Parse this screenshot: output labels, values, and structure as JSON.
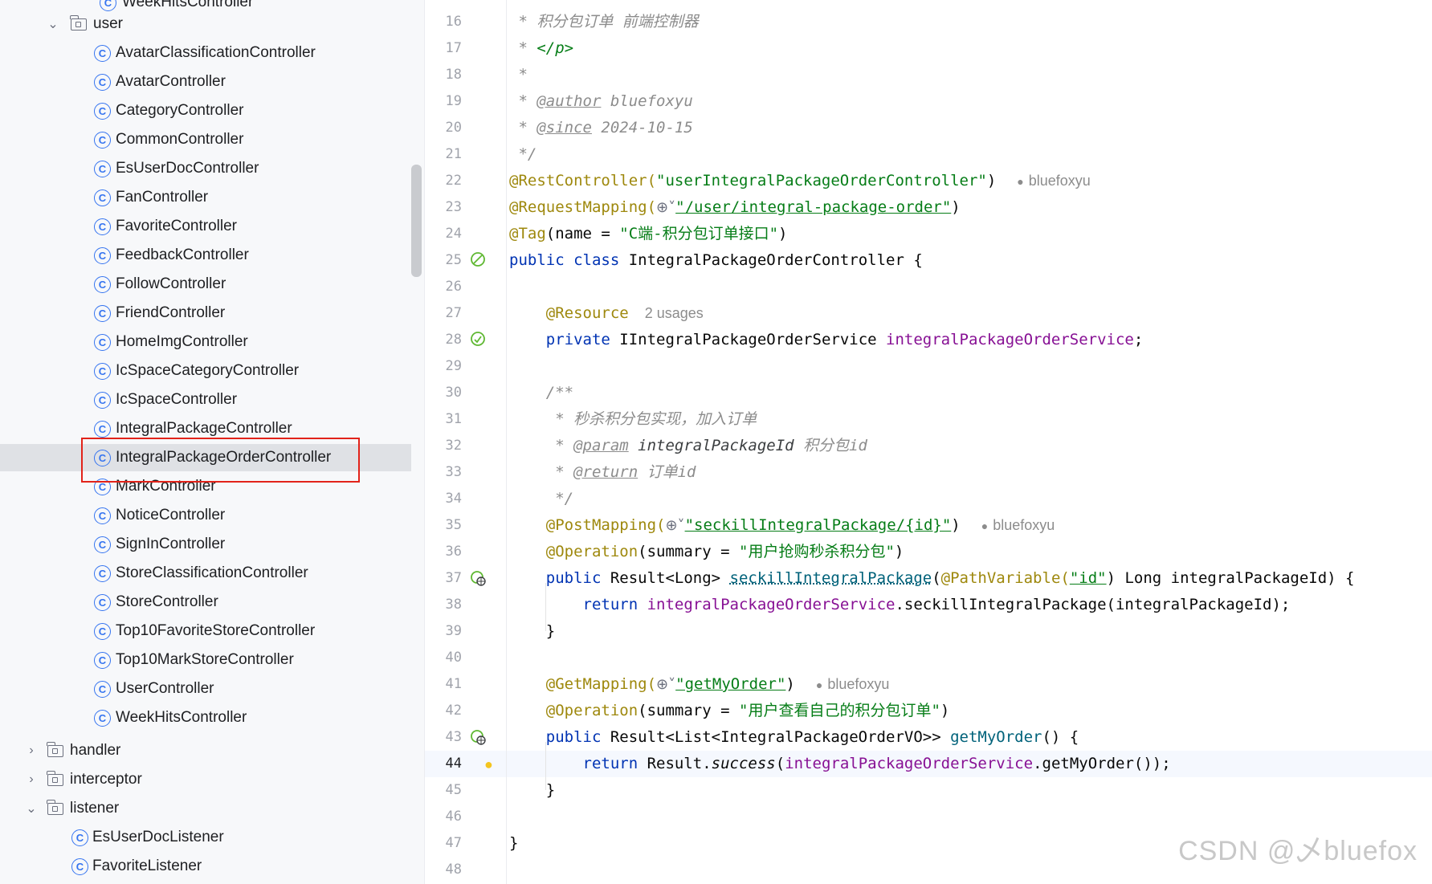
{
  "tree": {
    "top_folder": "user",
    "user_classes": [
      "AvatarClassificationController",
      "AvatarController",
      "CategoryController",
      "CommonController",
      "EsUserDocController",
      "FanController",
      "FavoriteController",
      "FeedbackController",
      "FollowController",
      "FriendController",
      "HomeImgController",
      "IcSpaceCategoryController",
      "IcSpaceController",
      "IntegralPackageController",
      "IntegralPackageOrderController",
      "MarkController",
      "NoticeController",
      "SignInController",
      "StoreClassificationController",
      "StoreController",
      "Top10FavoriteStoreController",
      "Top10MarkStoreController",
      "UserController",
      "WeekHitsController"
    ],
    "selected": "IntegralPackageOrderController",
    "folders": [
      "handler",
      "interceptor",
      "listener"
    ],
    "listener_classes": [
      "EsUserDocListener",
      "FavoriteListener"
    ]
  },
  "editor": {
    "line_numbers": [
      "16",
      "17",
      "18",
      "19",
      "20",
      "21",
      "22",
      "23",
      "24",
      "25",
      "26",
      "27",
      "28",
      "29",
      "30",
      "31",
      "32",
      "33",
      "34",
      "35",
      "36",
      "37",
      "38",
      "39",
      "40",
      "41",
      "42",
      "43",
      "44",
      "45",
      "46",
      "47",
      "48"
    ],
    "current_line": "44",
    "code": {
      "l16": " * 积分包订单 前端控制器",
      "l17_a": " * ",
      "l17_b": "</p>",
      "l18": " *",
      "l19_a": " * ",
      "l19_b": "@author",
      "l19_c": " bluefoxyu",
      "l20_a": " * ",
      "l20_b": "@since",
      "l20_c": " 2024-10-15",
      "l21": " */",
      "l22_a": "@RestController(",
      "l22_b": "\"userIntegralPackageOrderController\"",
      "l22_c": ")",
      "l23_a": "@RequestMapping(",
      "l23_b": "\"/user/integral-package-order\"",
      "l23_c": ")",
      "l24_a": "@Tag",
      "l24_b": "(name = ",
      "l24_c": "\"C端-积分包订单接口\"",
      "l24_d": ")",
      "l25_a": "public class",
      "l25_b": " IntegralPackageOrderController {",
      "l27": "    @Resource",
      "l28_a": "    private",
      "l28_b": " IIntegralPackageOrderService ",
      "l28_c": "integralPackageOrderService",
      "l28_d": ";",
      "l30": "    /**",
      "l31": "     * 秒杀积分包实现，加入订单",
      "l32_a": "     * ",
      "l32_b": "@param",
      "l32_c": " integralPackageId",
      "l32_d": " 积分包id",
      "l33_a": "     * ",
      "l33_b": "@return",
      "l33_c": " 订单id",
      "l34": "     */",
      "l35_a": "    @PostMapping(",
      "l35_b": "\"seckillIntegralPackage/{id}\"",
      "l35_c": ")",
      "l36_a": "    @Operation",
      "l36_b": "(summary = ",
      "l36_c": "\"用户抢购秒杀积分包\"",
      "l36_d": ")",
      "l37_a": "    public",
      "l37_b": " Result<Long> ",
      "l37_c": "seckillIntegralPackage",
      "l37_d": "(",
      "l37_e": "@PathVariable(",
      "l37_f": "\"id\"",
      "l37_g": ")",
      "l37_h": " Long integralPackageId) {",
      "l38_a": "        return",
      "l38_b": " integralPackageOrderService",
      "l38_c": ".seckillIntegralPackage(integralPackageId);",
      "l39": "    }",
      "l41_a": "    @GetMapping(",
      "l41_b": "\"getMyOrder\"",
      "l41_c": ")",
      "l42_a": "    @Operation",
      "l42_b": "(summary = ",
      "l42_c": "\"用户查看自己的积分包订单\"",
      "l42_d": ")",
      "l43_a": "    public",
      "l43_b": " Result<List<IntegralPackageOrderVO>> ",
      "l43_c": "getMyOrder",
      "l43_d": "() {",
      "l44_a": "        return",
      "l44_b": " Result.",
      "l44_c": "success",
      "l44_d": "(",
      "l44_e": "integralPackageOrderService",
      "l44_f": ".getMyOrder());",
      "l45": "    }",
      "l47": "}"
    },
    "author_hint": "bluefoxyu",
    "usages_hint": "2 usages"
  },
  "watermark": "CSDN @乄bluefox",
  "icons": {
    "class_icon": "C",
    "globe_icon": "⊕˅",
    "person_icon": "👤",
    "bulb_icon": "💡"
  },
  "colors": {
    "keyword": "#0033b3",
    "annotation": "#9e880d",
    "string": "#067d17",
    "field": "#871094",
    "comment": "#8c8c8c",
    "selection_box": "#e2231a",
    "class_icon": "#3574f0"
  }
}
